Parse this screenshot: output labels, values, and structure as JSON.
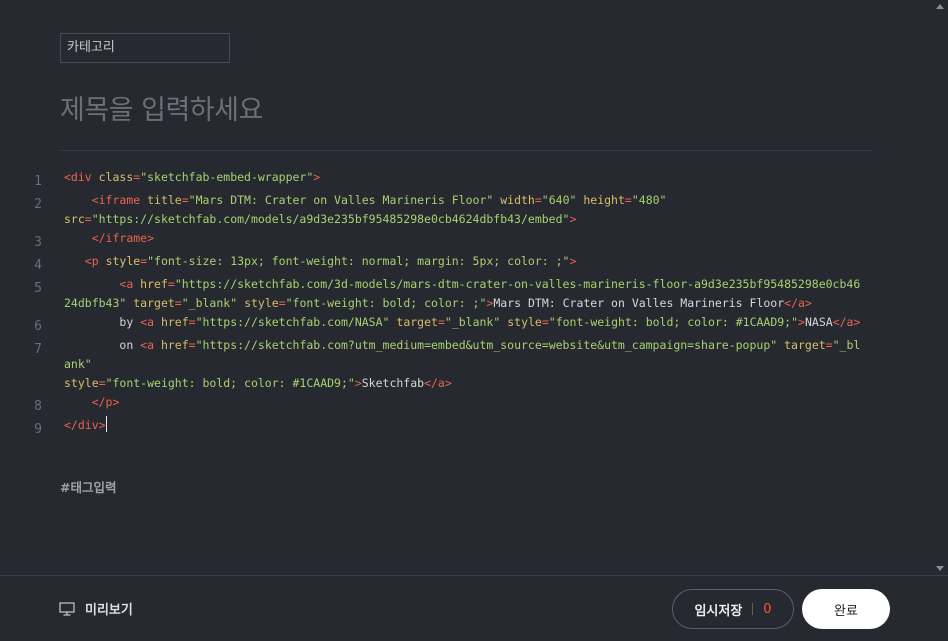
{
  "category": {
    "label": "카테고리"
  },
  "title": {
    "placeholder": "제목을 입력하세요"
  },
  "editor": {
    "lines": [
      {
        "n": "1",
        "segs": [
          [
            "t",
            "<div "
          ],
          [
            "a",
            "class"
          ],
          [
            "t",
            "="
          ],
          [
            "s",
            "\"sketchfab-embed-wrapper\""
          ],
          [
            "t",
            ">"
          ]
        ]
      },
      {
        "n": "2",
        "segs": [
          [
            "p",
            "    "
          ],
          [
            "t",
            "<iframe "
          ],
          [
            "a",
            "title"
          ],
          [
            "t",
            "="
          ],
          [
            "s",
            "\"Mars DTM: Crater on Valles Marineris Floor\""
          ],
          [
            "p",
            " "
          ],
          [
            "a",
            "width"
          ],
          [
            "t",
            "="
          ],
          [
            "s",
            "\"640\""
          ],
          [
            "p",
            " "
          ],
          [
            "a",
            "height"
          ],
          [
            "t",
            "="
          ],
          [
            "s",
            "\"480\""
          ],
          [
            "p",
            "\n"
          ],
          [
            "a",
            "src"
          ],
          [
            "t",
            "="
          ],
          [
            "s",
            "\"https://sketchfab.com/models/a9d3e235bf95485298e0cb4624dbfb43/embed\""
          ],
          [
            "t",
            ">"
          ]
        ]
      },
      {
        "n": "3",
        "segs": [
          [
            "p",
            "    "
          ],
          [
            "t",
            "</iframe>"
          ]
        ]
      },
      {
        "n": "4",
        "segs": [
          [
            "p",
            "   "
          ],
          [
            "t",
            "<p "
          ],
          [
            "a",
            "style"
          ],
          [
            "t",
            "="
          ],
          [
            "s",
            "\"font-size: 13px; font-weight: normal; margin: 5px; color: ;\""
          ],
          [
            "t",
            ">"
          ]
        ]
      },
      {
        "n": "5",
        "segs": [
          [
            "p",
            "        "
          ],
          [
            "t",
            "<a "
          ],
          [
            "a",
            "href"
          ],
          [
            "t",
            "="
          ],
          [
            "s",
            "\"https://sketchfab.com/3d-models/mars-dtm-crater-on-valles-marineris-floor-a9d3e235bf95485298e0cb4624dbfb43\""
          ],
          [
            "p",
            " "
          ],
          [
            "a",
            "target"
          ],
          [
            "t",
            "="
          ],
          [
            "s",
            "\"_blank\""
          ],
          [
            "p",
            " "
          ],
          [
            "a",
            "style"
          ],
          [
            "t",
            "="
          ],
          [
            "s",
            "\"font-weight: bold; color: ;\""
          ],
          [
            "t",
            ">"
          ],
          [
            "p",
            "Mars DTM: Crater on Valles Marineris Floor"
          ],
          [
            "t",
            "</a>"
          ]
        ]
      },
      {
        "n": "6",
        "segs": [
          [
            "p",
            "        by "
          ],
          [
            "t",
            "<a "
          ],
          [
            "a",
            "href"
          ],
          [
            "t",
            "="
          ],
          [
            "s",
            "\"https://sketchfab.com/NASA\""
          ],
          [
            "p",
            " "
          ],
          [
            "a",
            "target"
          ],
          [
            "t",
            "="
          ],
          [
            "s",
            "\"_blank\""
          ],
          [
            "p",
            " "
          ],
          [
            "a",
            "style"
          ],
          [
            "t",
            "="
          ],
          [
            "s",
            "\"font-weight: bold; color: #1CAAD9;\""
          ],
          [
            "t",
            ">"
          ],
          [
            "p",
            "NASA"
          ],
          [
            "t",
            "</a>"
          ]
        ]
      },
      {
        "n": "7",
        "segs": [
          [
            "p",
            "        on "
          ],
          [
            "t",
            "<a "
          ],
          [
            "a",
            "href"
          ],
          [
            "t",
            "="
          ],
          [
            "s",
            "\"https://sketchfab.com?utm_medium=embed&utm_source=website&utm_campaign=share-popup\""
          ],
          [
            "p",
            " "
          ],
          [
            "a",
            "target"
          ],
          [
            "t",
            "="
          ],
          [
            "s",
            "\"_blank\""
          ],
          [
            "p",
            "\n"
          ],
          [
            "a",
            "style"
          ],
          [
            "t",
            "="
          ],
          [
            "s",
            "\"font-weight: bold; color: #1CAAD9;\""
          ],
          [
            "t",
            ">"
          ],
          [
            "p",
            "Sketchfab"
          ],
          [
            "t",
            "</a>"
          ]
        ]
      },
      {
        "n": "8",
        "segs": [
          [
            "p",
            "    "
          ],
          [
            "t",
            "</p>"
          ]
        ]
      },
      {
        "n": "9",
        "segs": [
          [
            "t",
            "</div>"
          ],
          [
            "c",
            ""
          ]
        ]
      }
    ]
  },
  "tags": {
    "placeholder": "#태그입력"
  },
  "footer": {
    "preview_label": "미리보기",
    "save_label": "임시저장",
    "save_count": "0",
    "done_label": "완료"
  },
  "colors": {
    "background": "#262930",
    "tag": "#e8644f",
    "attribute": "#d9be68",
    "string": "#a7d16f",
    "accent": "#ef5a2b"
  },
  "icons": {
    "preview": "monitor-icon",
    "scroll_up": "arrow-up-icon",
    "scroll_down": "arrow-down-icon"
  }
}
